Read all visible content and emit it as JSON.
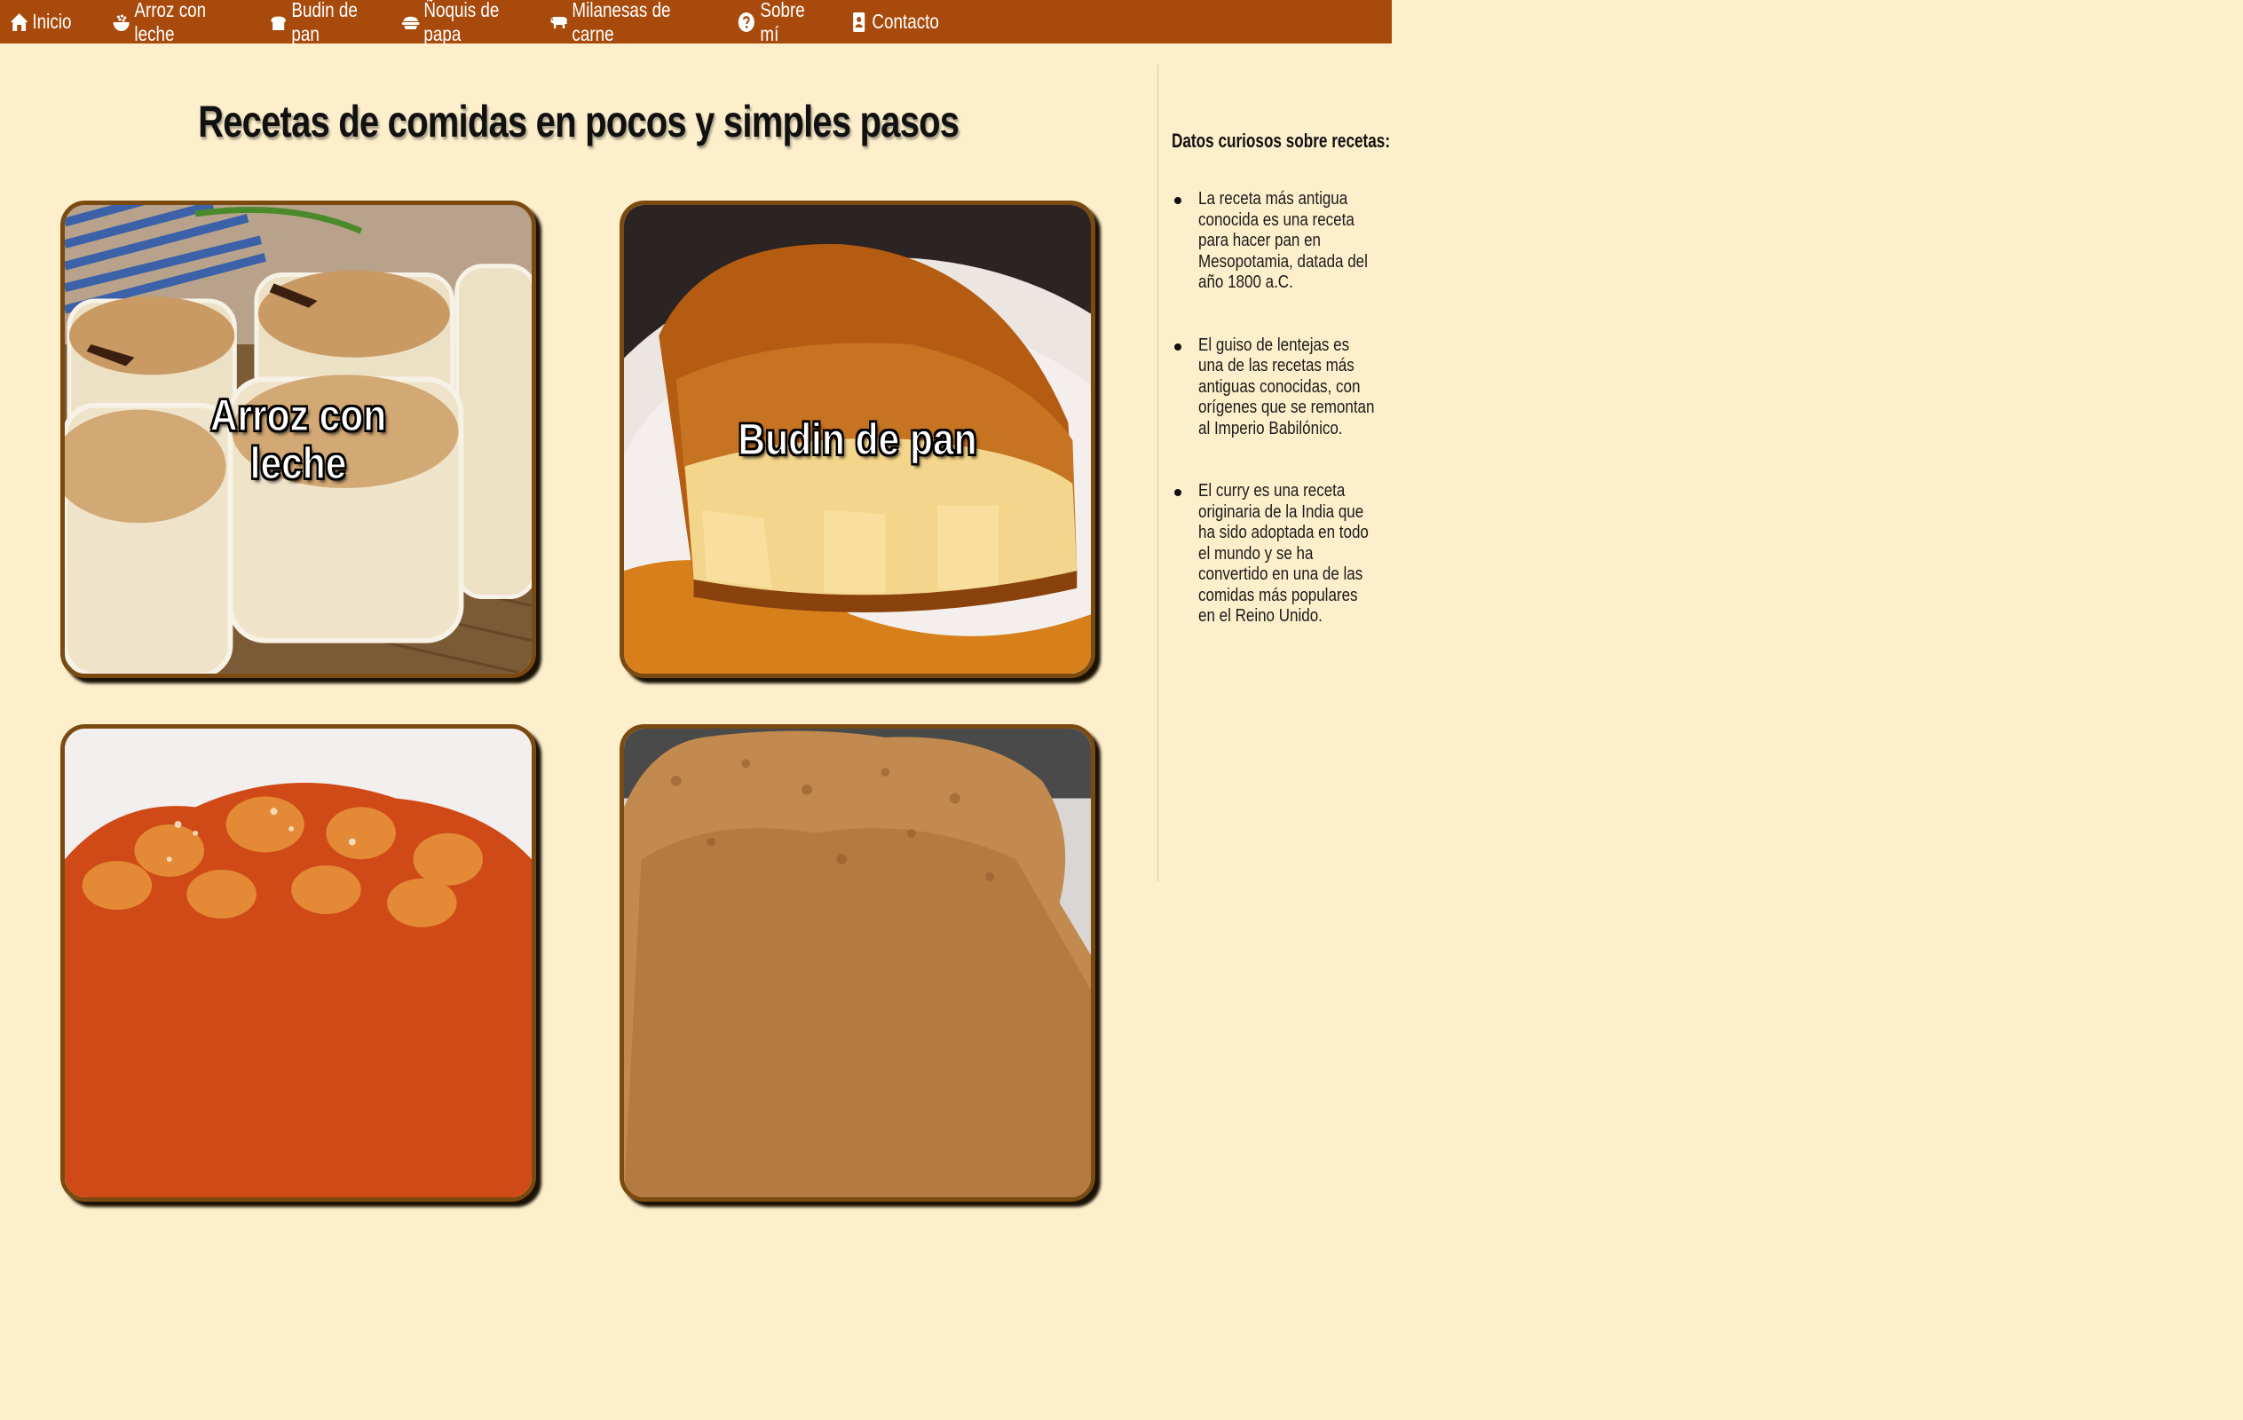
{
  "nav": {
    "items": [
      {
        "label": "Inicio",
        "icon": "home-icon"
      },
      {
        "label": "Arroz con leche",
        "icon": "rice-bowl-icon"
      },
      {
        "label": "Budin de pan",
        "icon": "bread-icon"
      },
      {
        "label": "Ñoquis de papa",
        "icon": "dish-icon"
      },
      {
        "label": "Milanesas de carne",
        "icon": "cow-icon"
      },
      {
        "label": "Sobre mí",
        "icon": "question-circle-icon"
      },
      {
        "label": "Contacto",
        "icon": "contact-card-icon"
      }
    ],
    "color": "#a84a0c"
  },
  "main": {
    "title": "Recetas de comidas en pocos y simples pasos",
    "cards": [
      {
        "label": "Arroz con leche"
      },
      {
        "label": "Budin de pan"
      },
      {
        "label": ""
      },
      {
        "label": ""
      }
    ]
  },
  "aside": {
    "title": "Datos curiosos sobre recetas:",
    "facts": [
      "La receta más antigua conocida es una receta para hacer pan en Mesopotamia, datada del año 1800 a.C.",
      "El guiso de lentejas es una de las recetas más antiguas conocidas, con orígenes que se remontan al Imperio Babilónico.",
      "El curry es una receta originaria de la India que ha sido adoptada en todo el mundo y se ha convertido en una de las comidas más populares en el Reino Unido."
    ]
  },
  "colors": {
    "background": "#fdefcb",
    "card_border": "#7a4a10"
  }
}
